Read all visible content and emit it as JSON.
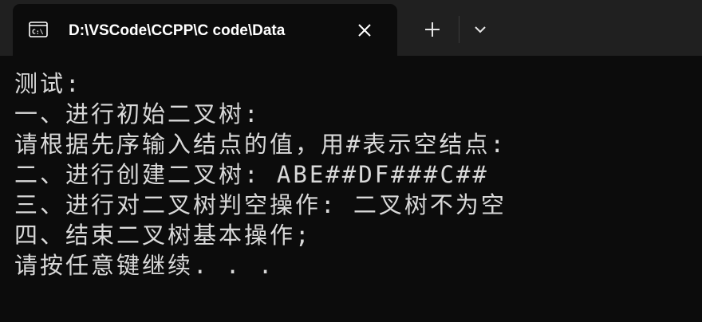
{
  "window": {
    "tab_title": "D:\\VSCode\\CCPP\\C code\\Data",
    "tab_icon": "terminal-icon",
    "close_icon": "close-icon",
    "new_tab_icon": "plus-icon",
    "dropdown_icon": "chevron-down-icon"
  },
  "console": {
    "lines": [
      "测试:",
      "一、进行初始二叉树:",
      "请根据先序输入结点的值，用#表示空结点:",
      "二、进行创建二叉树: ABE##DF###C##",
      "三、进行对二叉树判空操作: 二叉树不为空",
      "四、结束二叉树基本操作;",
      "请按任意键继续. . ."
    ]
  },
  "colors": {
    "titlebar": "#202020",
    "background": "#0c0c0c",
    "text": "#d9d9d9",
    "tab_title_text": "#ffffff"
  }
}
